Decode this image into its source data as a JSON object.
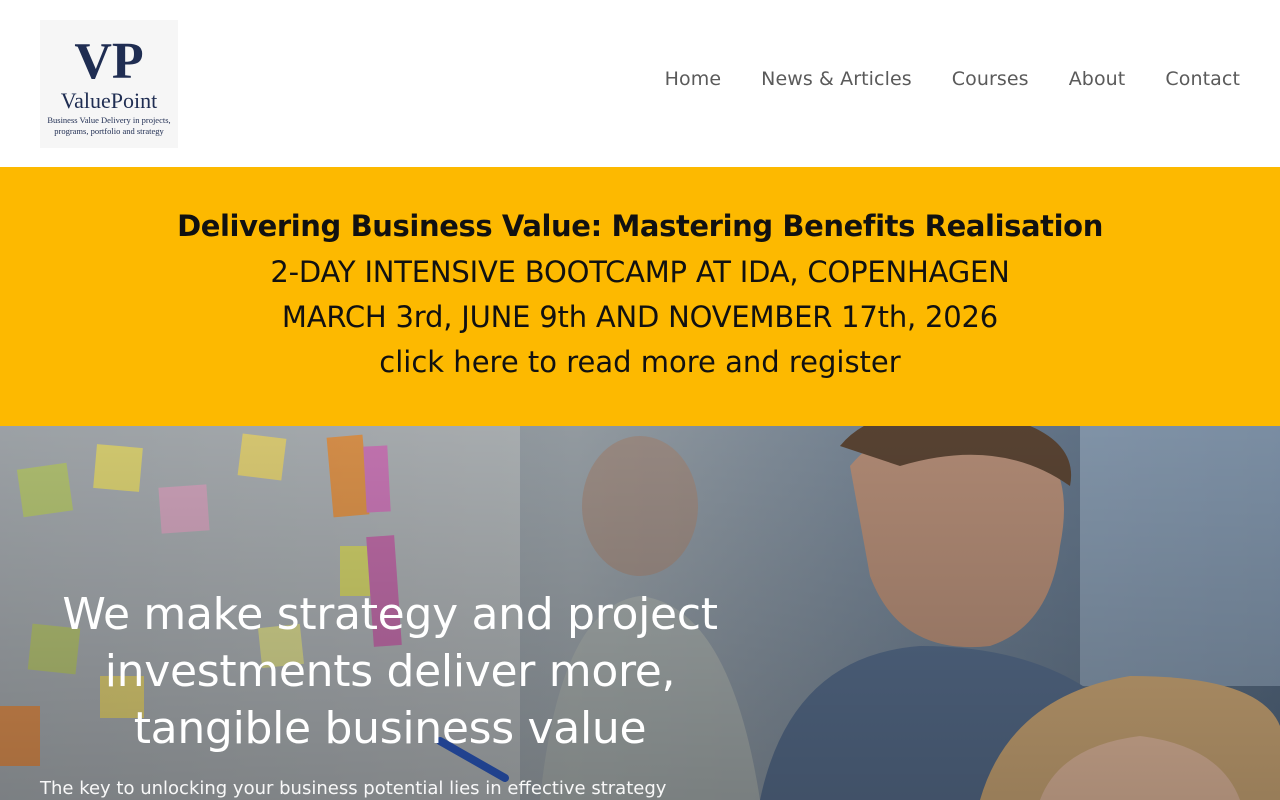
{
  "header": {
    "logo": {
      "monogram": "VP",
      "name": "ValuePoint",
      "tagline_line1": "Business Value Delivery in projects,",
      "tagline_line2": "programs, portfolio and strategy"
    },
    "nav": [
      {
        "label": "Home"
      },
      {
        "label": "News & Articles"
      },
      {
        "label": "Courses"
      },
      {
        "label": "About"
      },
      {
        "label": "Contact"
      }
    ]
  },
  "banner": {
    "title": "Delivering Business Value: Mastering Benefits Realisation",
    "line1": "2-DAY INTENSIVE BOOTCAMP AT IDA, COPENHAGEN",
    "line2": "MARCH 3rd, JUNE 9th AND NOVEMBER 17th, 2026",
    "link": "click here to read more and register",
    "background_color": "#fdb900"
  },
  "hero": {
    "heading": "We make strategy and project investments deliver more, tangible business value",
    "subtext": "The key to unlocking your business potential lies in effective strategy"
  }
}
